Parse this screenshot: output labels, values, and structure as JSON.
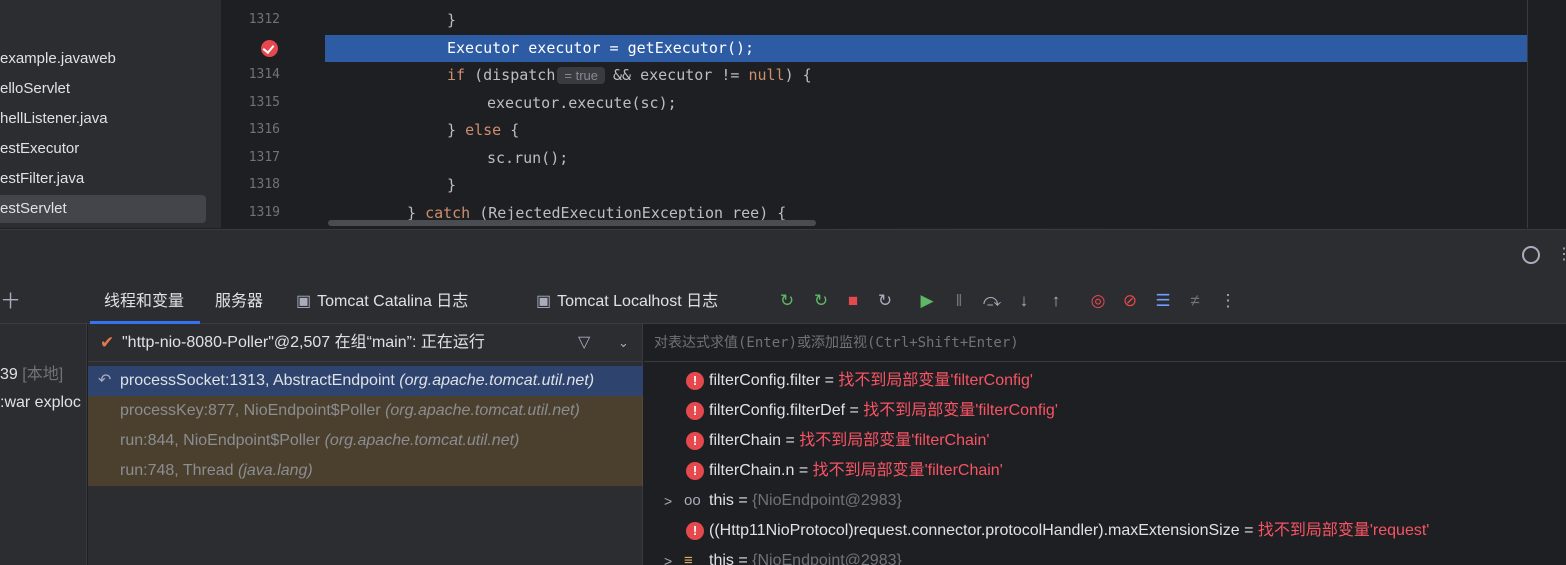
{
  "project_tree": [
    "example.javaweb",
    "elloServlet",
    "hellListener.java",
    "estExecutor",
    "estFilter.java",
    "estServlet"
  ],
  "editor": {
    "lines": [
      {
        "num": "1312",
        "text": "}",
        "indent": 2
      },
      {
        "num": "",
        "text": "Executor executor = getExecutor();",
        "indent": 2
      },
      {
        "num": "1314",
        "pre_kw": "if",
        "text": " (dispatch",
        "hint": "= true",
        "post": "&& executor != ",
        "kw2": "null",
        "tail": ") {",
        "indent": 2
      },
      {
        "num": "1315",
        "text": "executor.execute(sc);",
        "indent": 3
      },
      {
        "num": "1316",
        "pre_kw": "",
        "text": "} ",
        "kw_mid": "else",
        "tail": " {",
        "indent": 2
      },
      {
        "num": "1317",
        "text": "sc.run();",
        "indent": 3
      },
      {
        "num": "1318",
        "text": "}",
        "indent": 2
      },
      {
        "num": "1319",
        "text": "} ",
        "kw_mid": "catch",
        "tail": " (RejectedExecutionException ree) {",
        "indent": 1
      }
    ]
  },
  "debug": {
    "tabs": [
      "线程和变量",
      "服务器",
      "Tomcat Catalina 日志",
      "Tomcat Localhost 日志"
    ],
    "left_rail": {
      "glyph": "十",
      "line1": "39",
      "line1_tag": "[本地]",
      "line2": ":war exploc"
    },
    "thread": "\"http-nio-8080-Poller\"@2,507 在组“main”: 正在运行",
    "frames": [
      {
        "method": "processSocket:1313, AbstractEndpoint",
        "pkg": "(org.apache.tomcat.util.net)"
      },
      {
        "method": "processKey:877, NioEndpoint$Poller",
        "pkg": "(org.apache.tomcat.util.net)"
      },
      {
        "method": "run:844, NioEndpoint$Poller",
        "pkg": "(org.apache.tomcat.util.net)"
      },
      {
        "method": "run:748, Thread",
        "pkg": "(java.lang)"
      }
    ],
    "eval_placeholder": "对表达式求值(Enter)或添加监视(Ctrl+Shift+Enter)",
    "vars": [
      {
        "name": "filterConfig.filter",
        "value": "找不到局部变量'filterConfig'",
        "kind": "error"
      },
      {
        "name": "filterConfig.filterDef",
        "value": "找不到局部变量'filterConfig'",
        "kind": "error"
      },
      {
        "name": "filterChain",
        "value": "找不到局部变量'filterChain'",
        "kind": "error"
      },
      {
        "name": "filterChain.n",
        "value": "找不到局部变量'filterChain'",
        "kind": "error"
      },
      {
        "name": "this",
        "value": "{NioEndpoint@2983}",
        "kind": "object"
      },
      {
        "name": "((Http11NioProtocol)request.connector.protocolHandler).maxExtensionSize",
        "value": "找不到局部变量'request'",
        "kind": "error"
      },
      {
        "name": "this",
        "value": "{NioEndpoint@2983}",
        "kind": "object2"
      }
    ]
  }
}
